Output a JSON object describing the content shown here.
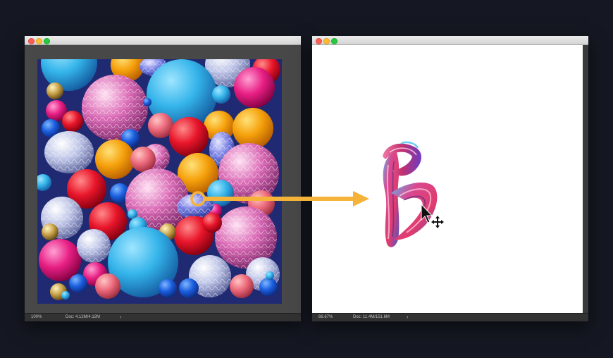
{
  "source_window": {
    "zoom": "100%",
    "doc_size": "Doc: 4.12M/4.12M",
    "chevron": "›",
    "image_subject": "colorful spheres photo"
  },
  "target_window": {
    "zoom": "66.67%",
    "doc_size": "Doc: 11.4M/151.6M",
    "chevron": "›",
    "content": "painted brush stroke letter"
  },
  "overlay": {
    "arrow_color": "#f6b33a",
    "sample_circle_color": "#f6b33a",
    "cursor": "move-cursor"
  },
  "colors": {
    "background": "#151822",
    "titlebar": "#dedede",
    "close": "#ff5f57",
    "minimize": "#ffbd2e",
    "maximize": "#28c941"
  }
}
